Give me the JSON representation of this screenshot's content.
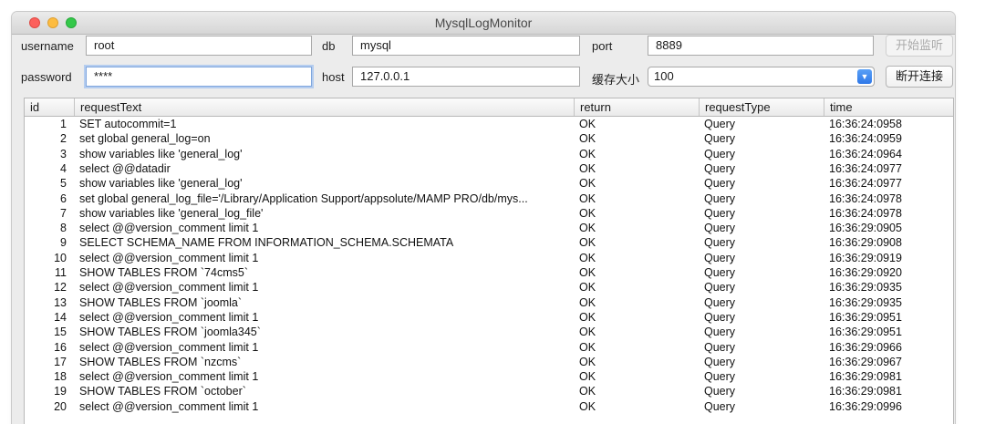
{
  "window": {
    "title": "MysqlLogMonitor"
  },
  "form": {
    "username_label": "username",
    "username_value": "root",
    "db_label": "db",
    "db_value": "mysql",
    "port_label": "port",
    "port_value": "8889",
    "password_label": "password",
    "password_value": "****",
    "host_label": "host",
    "host_value": "127.0.0.1",
    "cache_label": "缓存大小",
    "cache_value": "100",
    "start_button": "开始监听",
    "disconnect_button": "断开连接"
  },
  "table": {
    "headers": [
      "id",
      "requestText",
      "return",
      "requestType",
      "time"
    ],
    "rows": [
      [
        "1",
        "SET autocommit=1",
        "OK",
        "Query",
        "16:36:24:0958"
      ],
      [
        "2",
        "set global general_log=on",
        "OK",
        "Query",
        "16:36:24:0959"
      ],
      [
        "3",
        "show variables like 'general_log'",
        "OK",
        "Query",
        "16:36:24:0964"
      ],
      [
        "4",
        "select @@datadir",
        "OK",
        "Query",
        "16:36:24:0977"
      ],
      [
        "5",
        "show variables like 'general_log'",
        "OK",
        "Query",
        "16:36:24:0977"
      ],
      [
        "6",
        "set global general_log_file='/Library/Application Support/appsolute/MAMP PRO/db/mys...",
        "OK",
        "Query",
        "16:36:24:0978"
      ],
      [
        "7",
        "show variables like 'general_log_file'",
        "OK",
        "Query",
        "16:36:24:0978"
      ],
      [
        "8",
        "select @@version_comment limit 1",
        "OK",
        "Query",
        "16:36:29:0905"
      ],
      [
        "9",
        "SELECT SCHEMA_NAME FROM INFORMATION_SCHEMA.SCHEMATA",
        "OK",
        "Query",
        "16:36:29:0908"
      ],
      [
        "10",
        "select @@version_comment limit 1",
        "OK",
        "Query",
        "16:36:29:0919"
      ],
      [
        "11",
        "SHOW TABLES FROM `74cms5`",
        "OK",
        "Query",
        "16:36:29:0920"
      ],
      [
        "12",
        "select @@version_comment limit 1",
        "OK",
        "Query",
        "16:36:29:0935"
      ],
      [
        "13",
        "SHOW TABLES FROM `joomla`",
        "OK",
        "Query",
        "16:36:29:0935"
      ],
      [
        "14",
        "select @@version_comment limit 1",
        "OK",
        "Query",
        "16:36:29:0951"
      ],
      [
        "15",
        "SHOW TABLES FROM `joomla345`",
        "OK",
        "Query",
        "16:36:29:0951"
      ],
      [
        "16",
        "select @@version_comment limit 1",
        "OK",
        "Query",
        "16:36:29:0966"
      ],
      [
        "17",
        "SHOW TABLES FROM `nzcms`",
        "OK",
        "Query",
        "16:36:29:0967"
      ],
      [
        "18",
        "select @@version_comment limit 1",
        "OK",
        "Query",
        "16:36:29:0981"
      ],
      [
        "19",
        "SHOW TABLES FROM `october`",
        "OK",
        "Query",
        "16:36:29:0981"
      ],
      [
        "20",
        "select @@version_comment limit 1",
        "OK",
        "Query",
        "16:36:29:0996"
      ]
    ]
  }
}
